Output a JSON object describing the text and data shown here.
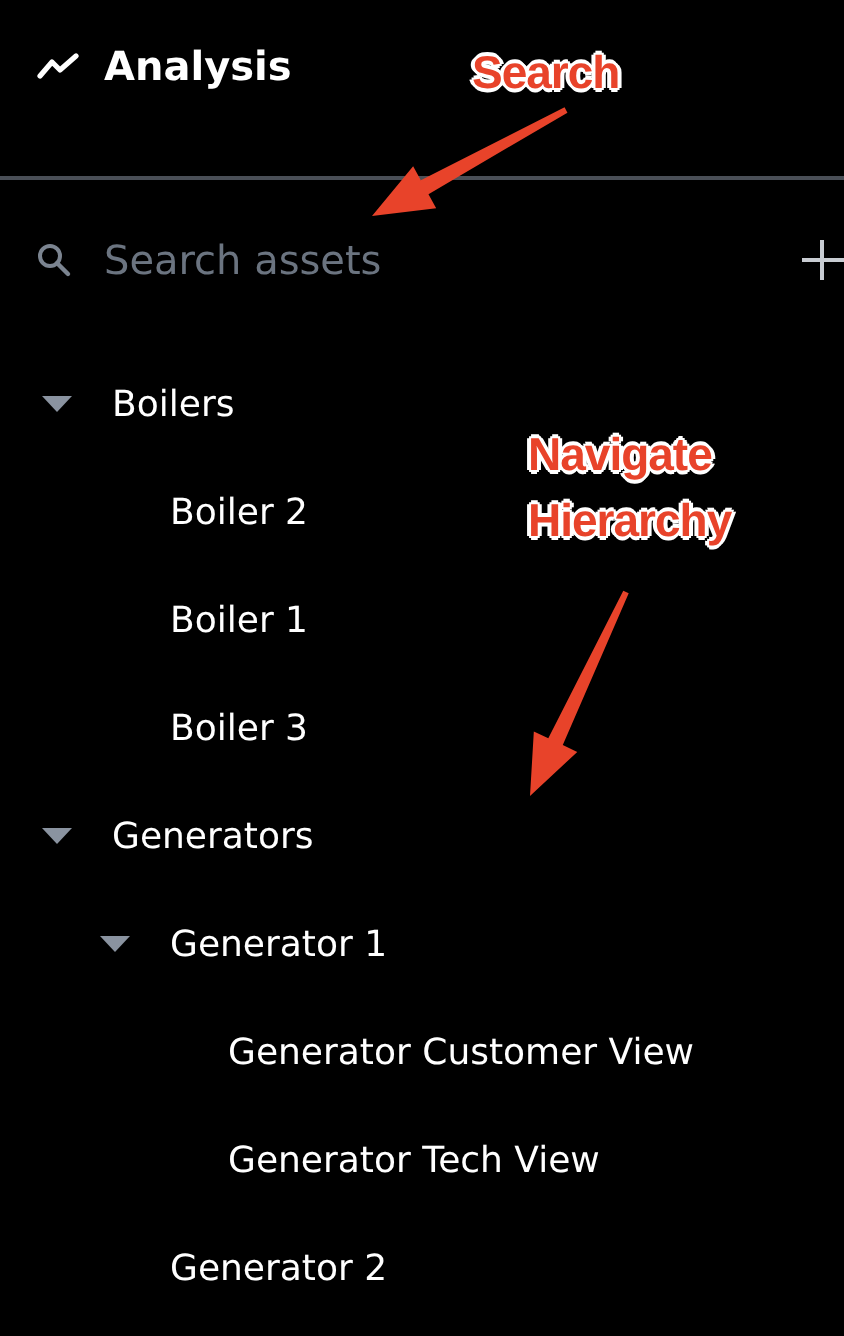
{
  "header": {
    "title": "Analysis"
  },
  "search": {
    "placeholder": "Search assets"
  },
  "tree": [
    {
      "label": "Boilers",
      "expanded": true,
      "children": [
        {
          "label": "Boiler 2"
        },
        {
          "label": "Boiler 1"
        },
        {
          "label": "Boiler 3"
        }
      ]
    },
    {
      "label": "Generators",
      "expanded": true,
      "children": [
        {
          "label": "Generator 1",
          "expanded": true,
          "children": [
            {
              "label": "Generator Customer View"
            },
            {
              "label": "Generator Tech View"
            }
          ]
        },
        {
          "label": "Generator 2"
        }
      ]
    }
  ],
  "annotations": [
    {
      "text": "Search"
    },
    {
      "text": "Navigate Hierarchy"
    }
  ]
}
